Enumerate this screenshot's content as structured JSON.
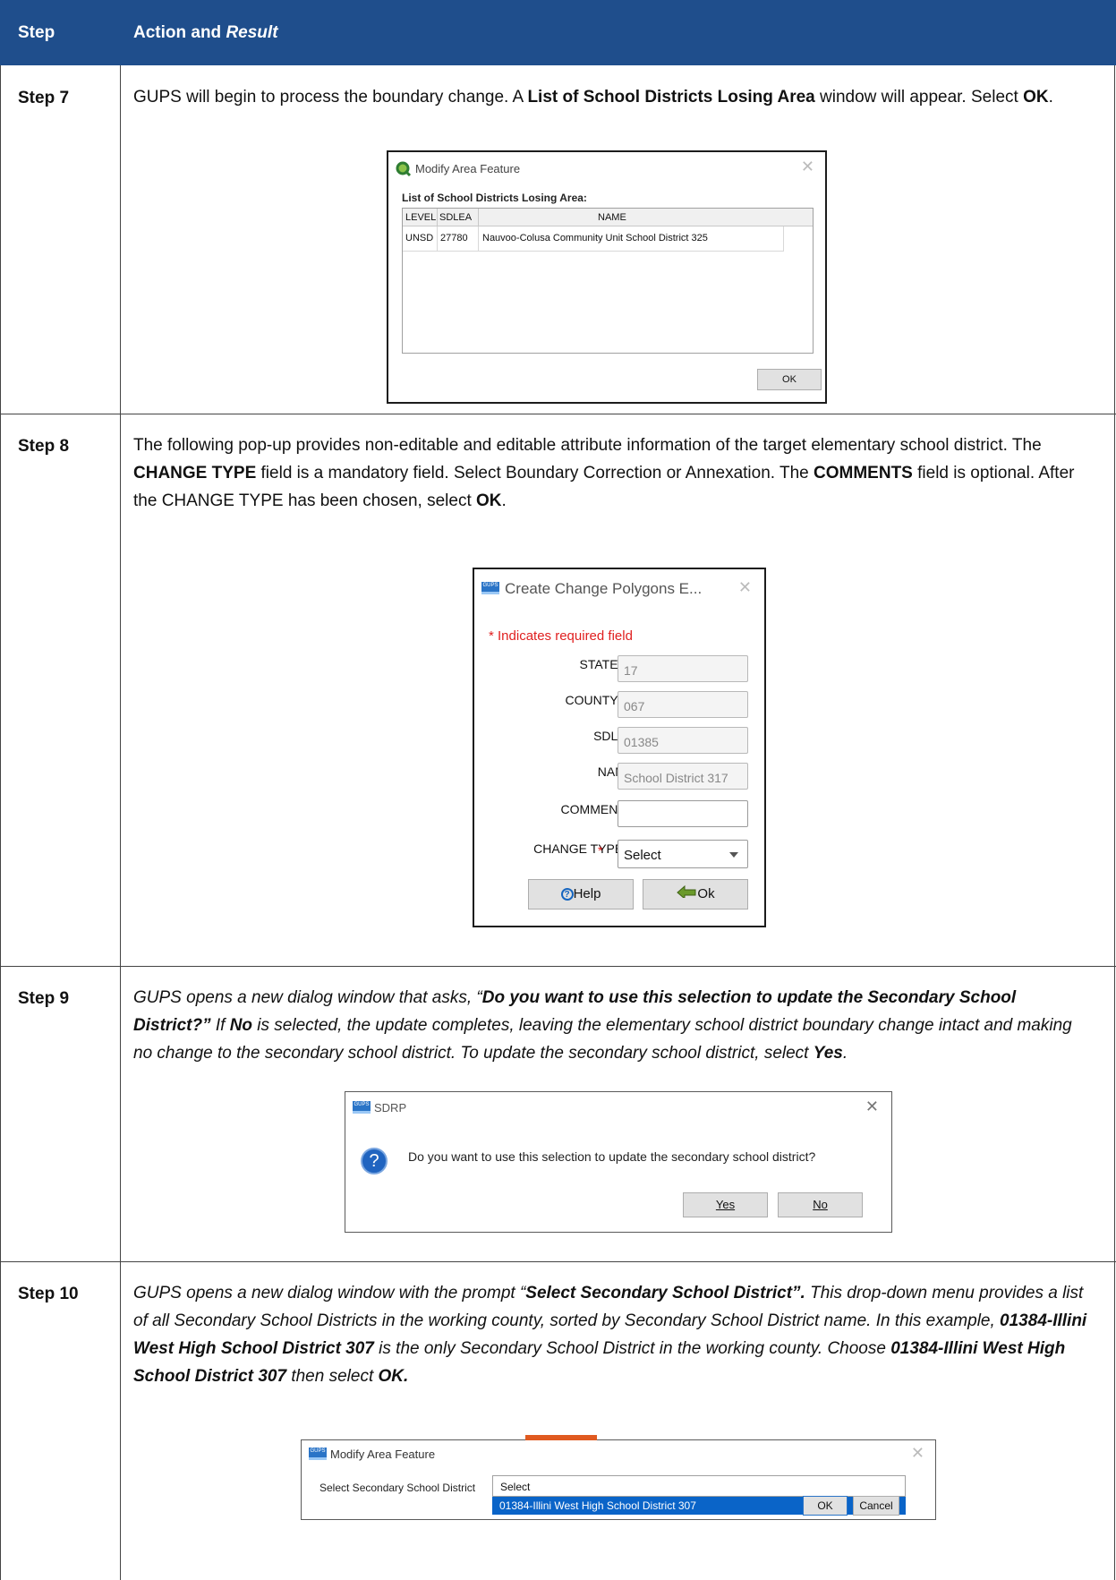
{
  "header": {
    "col1": "Step",
    "col2_part1": "Action and ",
    "col2_part2": "Result"
  },
  "steps": [
    {
      "label": "Step 7",
      "text_parts": [
        "GUPS will begin to process the boundary change. A ",
        "List of School Districts Losing Area",
        " window will appear. Select ",
        "OK",
        "."
      ]
    },
    {
      "label": "Step 8",
      "text_parts": [
        "The following pop-up provides non-editable and editable attribute information of the target elementary school district. The ",
        "CHANGE TYPE",
        " field is a mandatory field. Select Boundary Correction or Annexation. The ",
        "COMMENTS",
        " field is optional. After the CHANGE TYPE has been chosen, select ",
        "OK",
        "."
      ]
    },
    {
      "label": "Step 9",
      "text_parts": [
        "GUPS opens a new dialog window that asks, “",
        "Do you want to use this selection to update the Secondary School District?”",
        " If ",
        "No",
        " is selected, the update completes, leaving the elementary school district boundary change intact and making no change to the secondary school district. To update the secondary school district, select ",
        "Yes",
        "."
      ]
    },
    {
      "label": "Step 10",
      "text_parts": [
        "GUPS opens a new dialog window with the prompt “",
        "Select Secondary School District”.",
        " This drop-down menu provides a list of all Secondary School Districts in the working county, sorted by Secondary School District name. In this example, ",
        "01384-Illini West High School District 307",
        " is the only Secondary School District in the working county. Choose ",
        "01384-Illini West High School District 307",
        " then select ",
        "OK."
      ]
    }
  ],
  "dialog7": {
    "title": "Modify Area Feature",
    "heading": "List of School Districts Losing Area:",
    "columns": [
      "LEVEL",
      "SDLEA",
      "NAME"
    ],
    "row": [
      "UNSD",
      "27780",
      "Nauvoo-Colusa Community Unit School District 325"
    ],
    "ok_label": "OK"
  },
  "dialog8": {
    "title": "Create Change Polygons E...",
    "required_note": "* Indicates required field",
    "fields": [
      {
        "label": "STATEFP :",
        "value": "17"
      },
      {
        "label": "COUNTYFP :",
        "value": "067"
      },
      {
        "label": "SDLEA :",
        "value": "01385"
      },
      {
        "label": "NAME :",
        "value": "School District 317"
      },
      {
        "label": "COMMENTS :",
        "value": ""
      }
    ],
    "change_type_label": "CHANGE TYPE :",
    "required_mark": "*",
    "change_type_value": "Select",
    "help_label": "Help",
    "ok_label": "Ok"
  },
  "dialog9": {
    "title": "SDRP",
    "message": "Do you want to use this selection to update the secondary school district?",
    "yes_label": "Yes",
    "no_label": "No"
  },
  "dialog10": {
    "title": "Modify Area Feature",
    "field_label": "Select Secondary School District",
    "select_value": "Select",
    "option": "01384-Illini West High School District 307",
    "ok_label": "OK",
    "cancel_label": "Cancel"
  },
  "colors": {
    "header_bg": "#1f4e8c",
    "required": "#e02020",
    "selection": "#0a64c8",
    "help_icon": "#1565c0"
  }
}
